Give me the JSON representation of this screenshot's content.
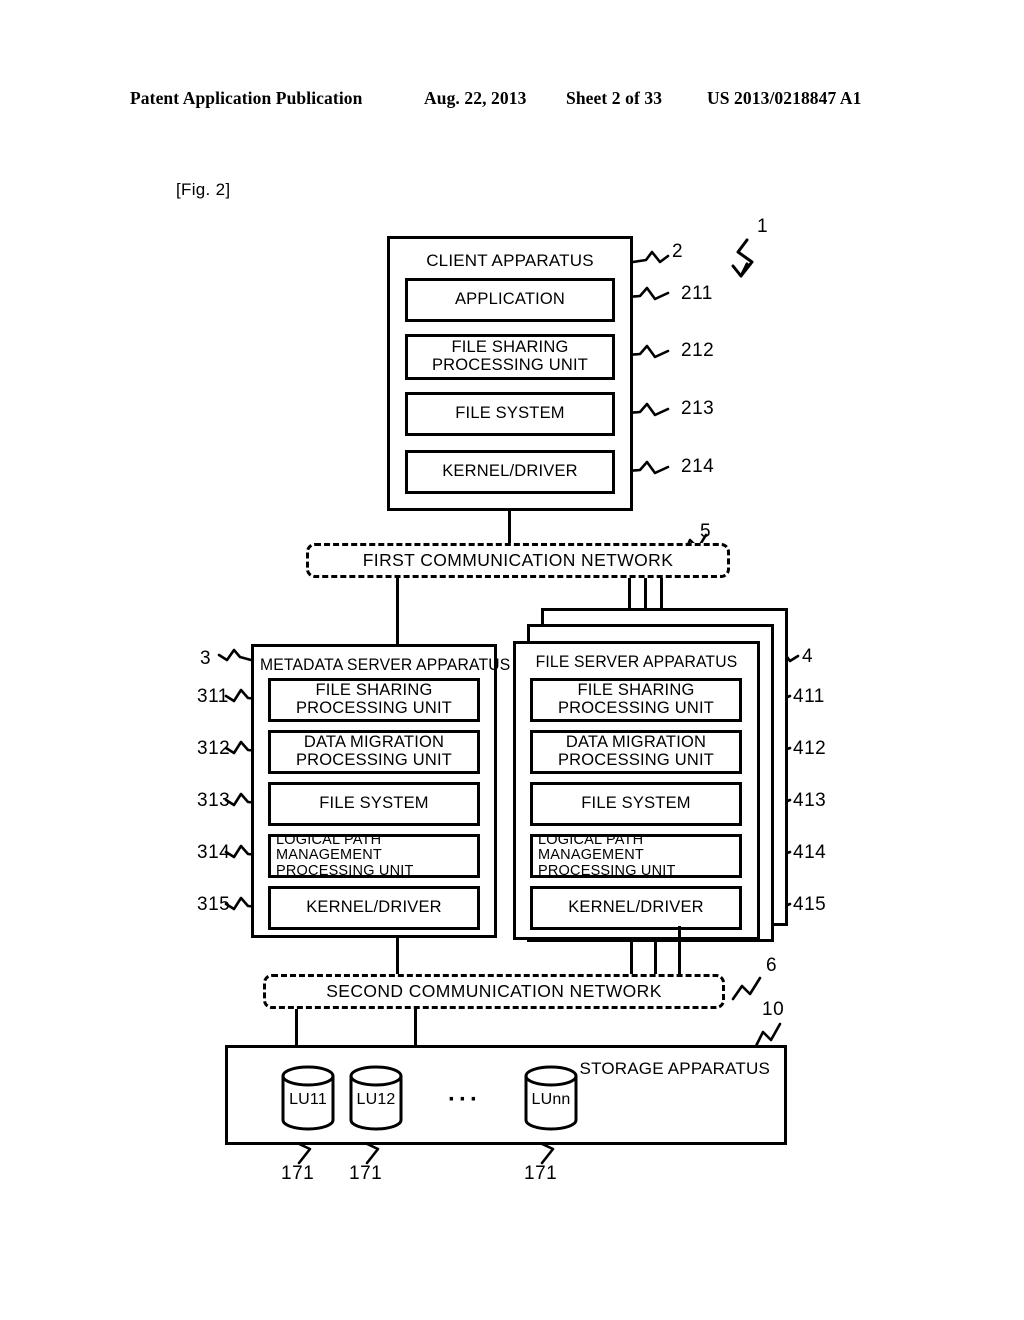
{
  "header": {
    "publication": "Patent Application Publication",
    "date": "Aug. 22, 2013",
    "sheet": "Sheet 2 of 33",
    "patent_number": "US 2013/0218847 A1"
  },
  "figure": {
    "label": "[Fig. 2]",
    "system_ref": "1"
  },
  "client_apparatus": {
    "title": "CLIENT APPARATUS",
    "ref": "2",
    "components": [
      {
        "label": "APPLICATION",
        "ref": "211"
      },
      {
        "label_line1": "FILE SHARING",
        "label_line2": "PROCESSING UNIT",
        "ref": "212"
      },
      {
        "label": "FILE SYSTEM",
        "ref": "213"
      },
      {
        "label": "KERNEL/DRIVER",
        "ref": "214"
      }
    ]
  },
  "first_network": {
    "label": "FIRST COMMUNICATION NETWORK",
    "ref": "5"
  },
  "metadata_server": {
    "title": "METADATA SERVER APPARATUS",
    "ref": "3",
    "components": [
      {
        "label_line1": "FILE SHARING",
        "label_line2": "PROCESSING UNIT",
        "ref": "311"
      },
      {
        "label_line1": "DATA MIGRATION",
        "label_line2": "PROCESSING UNIT",
        "ref": "312"
      },
      {
        "label": "FILE SYSTEM",
        "ref": "313"
      },
      {
        "label_line1": "LOGICAL PATH MANAGEMENT",
        "label_line2": "PROCESSING UNIT",
        "ref": "314"
      },
      {
        "label": "KERNEL/DRIVER",
        "ref": "315"
      }
    ]
  },
  "file_server": {
    "title": "FILE SERVER APPARATUS",
    "ref": "4",
    "components": [
      {
        "label_line1": "FILE SHARING",
        "label_line2": "PROCESSING UNIT",
        "ref": "411"
      },
      {
        "label_line1": "DATA MIGRATION",
        "label_line2": "PROCESSING UNIT",
        "ref": "412"
      },
      {
        "label": "FILE SYSTEM",
        "ref": "413"
      },
      {
        "label_line1": "LOGICAL PATH MANAGEMENT",
        "label_line2": "PROCESSING UNIT",
        "ref": "414"
      },
      {
        "label": "KERNEL/DRIVER",
        "ref": "415"
      }
    ]
  },
  "second_network": {
    "label": "SECOND COMMUNICATION NETWORK",
    "ref": "6"
  },
  "storage_apparatus": {
    "title": "STORAGE APPARATUS",
    "ref": "10",
    "ellipsis": "···",
    "volumes": [
      {
        "label": "LU11",
        "ref": "171"
      },
      {
        "label": "LU12",
        "ref": "171"
      },
      {
        "label": "LUnn",
        "ref": "171"
      }
    ]
  }
}
